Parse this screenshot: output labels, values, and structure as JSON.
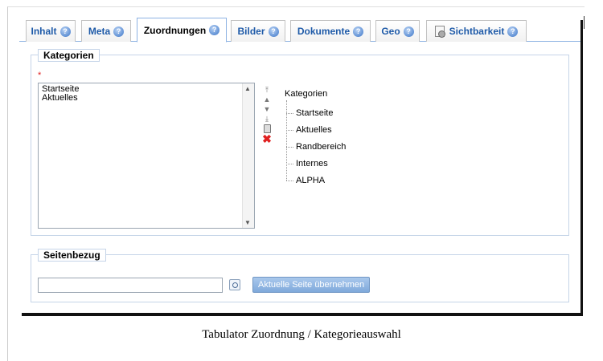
{
  "tabs": [
    {
      "label": "Inhalt",
      "active": false
    },
    {
      "label": "Meta",
      "active": false
    },
    {
      "label": "Zuordnungen",
      "active": true
    },
    {
      "label": "Bilder",
      "active": false
    },
    {
      "label": "Dokumente",
      "active": false
    },
    {
      "label": "Geo",
      "active": false
    },
    {
      "label": "Sichtbarkeit",
      "active": false
    }
  ],
  "kategorien": {
    "legend": "Kategorien",
    "required_marker": "*",
    "selected_items": [
      "Startseite",
      "Aktuelles"
    ],
    "tree": {
      "root": "Kategorien",
      "children": [
        "Startseite",
        "Aktuelles",
        "Randbereich",
        "Internes",
        "ALPHA"
      ]
    },
    "ordering_icons": [
      "move-top-icon",
      "move-up-icon",
      "move-down-icon",
      "move-bottom-icon",
      "trash-icon",
      "delete-icon"
    ]
  },
  "seitenbezug": {
    "legend": "Seitenbezug",
    "input_value": "",
    "button_label": "Aktuelle Seite übernehmen"
  },
  "caption": "Tabulator Zuordnung / Kategorieauswahl",
  "colors": {
    "tab_text": "#1e5aa8",
    "button_bg": "#8fb3e1",
    "required": "#e02020",
    "delete": "#e02020"
  }
}
